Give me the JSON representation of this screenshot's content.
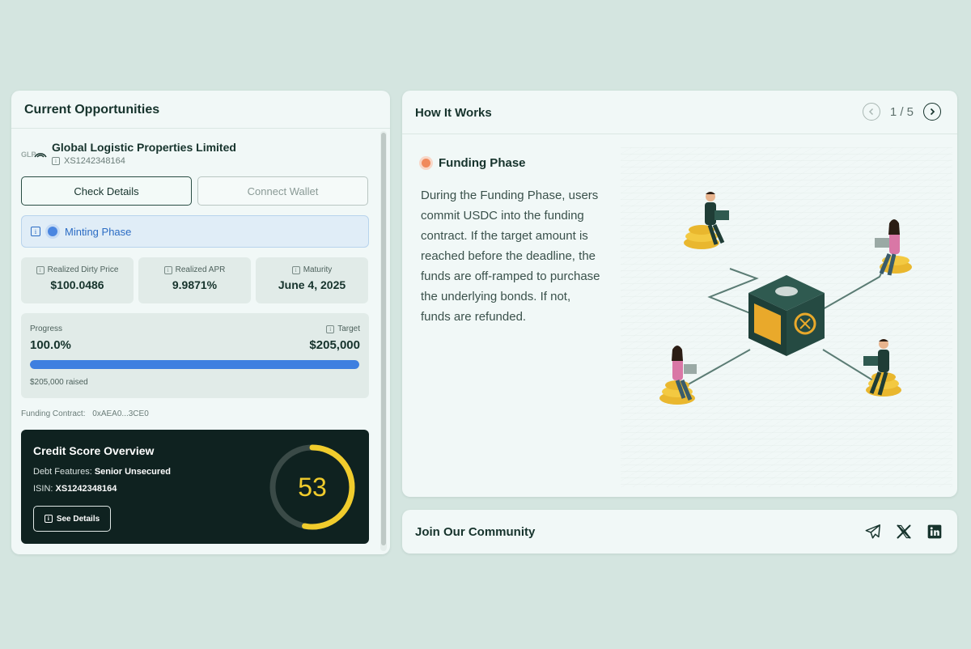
{
  "left_panel": {
    "title": "Current Opportunities",
    "issuer": {
      "name": "Global Logistic Properties Limited",
      "code": "XS1242348164"
    },
    "buttons": {
      "check_details": "Check Details",
      "connect_wallet": "Connect Wallet"
    },
    "phase": {
      "label": "Minting Phase"
    },
    "stats": [
      {
        "label": "Realized Dirty Price",
        "value": "$100.0486"
      },
      {
        "label": "Realized APR",
        "value": "9.9871%"
      },
      {
        "label": "Maturity",
        "value": "June 4, 2025"
      }
    ],
    "progress": {
      "label": "Progress",
      "value": "100.0%",
      "target_label": "Target",
      "target_value": "$205,000",
      "raised": "$205,000 raised",
      "fraction": 1.0
    },
    "contract": {
      "label": "Funding Contract:",
      "address": "0xAEA0...3CE0"
    },
    "credit": {
      "title": "Credit Score Overview",
      "debt_label": "Debt Features:",
      "debt_value": "Senior Unsecured",
      "isin_label": "ISIN:",
      "isin_value": "XS1242348164",
      "see_details": "See Details",
      "score": "53",
      "score_fraction": 0.53,
      "accent": "#f1cc2c"
    }
  },
  "how_it_works": {
    "title": "How It Works",
    "page": "1 / 5",
    "step_title": "Funding Phase",
    "step_text": "During the Funding Phase, users commit USDC into the funding contract. If the target amount is reached before the deadline, the funds are off-ramped to purchase the underlying bonds. If not, funds are refunded."
  },
  "community": {
    "title": "Join Our Community",
    "icons": [
      "telegram-icon",
      "x-icon",
      "linkedin-icon"
    ]
  },
  "colors": {
    "progress_fill": "#3e7fe0",
    "phase": "#2b6cc4",
    "step_dot": "#f08a5d"
  }
}
